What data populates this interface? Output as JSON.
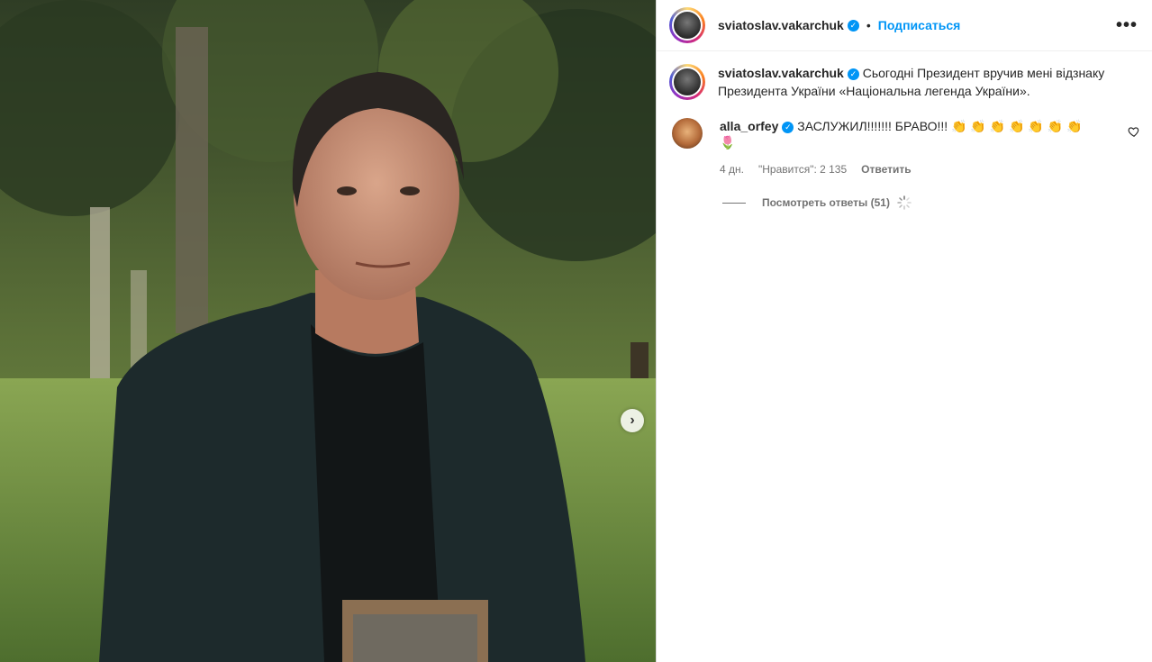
{
  "post_header": {
    "username": "sviatoslav.vakarchuk",
    "separator": "•",
    "follow_label": "Подписаться",
    "more_label": "•••"
  },
  "caption": {
    "username": "sviatoslav.vakarchuk",
    "text": "Сьогодні Президент вручив мені відзнаку Президента України «Національна легенда України»."
  },
  "comments": [
    {
      "username": "alla_orfey",
      "text": "ЗАСЛУЖИЛ!!!!!!! БРАВО!!! 👏 👏 👏 👏 👏 👏 👏 🌷",
      "time": "4 дн.",
      "likes": "\"Нравится\": 2 135",
      "reply_label": "Ответить",
      "view_replies": "Посмотреть ответы (51)"
    }
  ],
  "carousel": {
    "next_label": "›"
  },
  "colors": {
    "accent": "#0095f6",
    "secondary_text": "#737373"
  }
}
